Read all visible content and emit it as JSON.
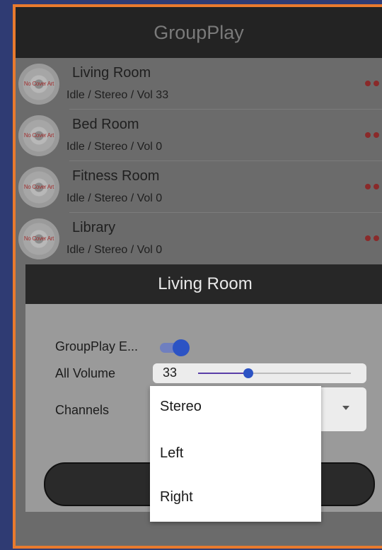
{
  "app": {
    "title": "GroupPlay"
  },
  "rooms": [
    {
      "name": "Living Room",
      "status": "Idle / Stereo / Vol 33",
      "cover_text": "No Cover Art"
    },
    {
      "name": "Bed Room",
      "status": "Idle / Stereo / Vol 0",
      "cover_text": "No Cover Art"
    },
    {
      "name": "Fitness Room",
      "status": "Idle / Stereo / Vol 0",
      "cover_text": "No Cover Art"
    },
    {
      "name": "Library",
      "status": "Idle / Stereo / Vol 0",
      "cover_text": "No Cover Art"
    }
  ],
  "dialog": {
    "title": "Living Room",
    "groupplay_label": "GroupPlay E...",
    "groupplay_enabled": true,
    "volume_label": "All Volume",
    "volume_value": "33",
    "volume_fraction": 0.33,
    "channels_label": "Channels",
    "channels_selected": "Stereo",
    "channels_options": [
      "Stereo",
      "Left",
      "Right"
    ]
  },
  "colors": {
    "frame_border": "#e87a2e",
    "accent_blue": "#2c53c4",
    "status_dots": "#8a2a2a"
  },
  "icons": {
    "more": "more-dots-icon",
    "dropdown": "caret-down-icon",
    "cover": "disc-icon"
  }
}
